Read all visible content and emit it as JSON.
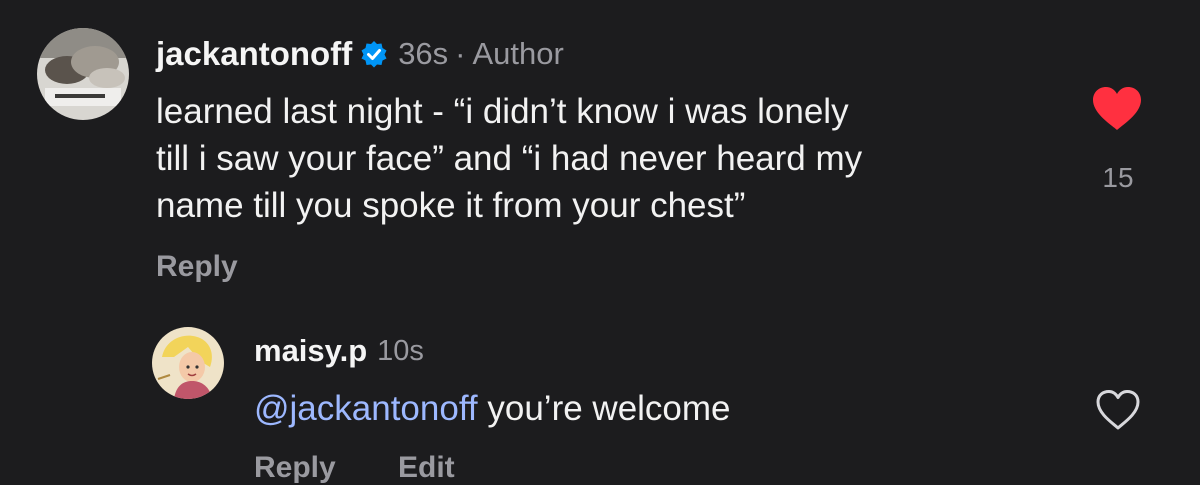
{
  "comment": {
    "username": "jackantonoff",
    "time": "36s",
    "separator": "·",
    "badge": "Author",
    "text_lines": [
      "learned last night - “i didn’t know i was lonely",
      "till i saw your face” and “i had never heard my",
      "name till you spoke it from your chest”"
    ],
    "reply_label": "Reply",
    "like_count": "15",
    "liked": true,
    "avatar_icon": "photo-avatar",
    "verified_icon": "verified-badge-icon"
  },
  "reply": {
    "username": "maisy.p",
    "time": "10s",
    "mention": "@jackantonoff",
    "text": " you’re welcome",
    "reply_label": "Reply",
    "edit_label": "Edit",
    "liked": false,
    "avatar_icon": "cartoon-avatar"
  },
  "colors": {
    "background": "#1c1c1e",
    "text": "#f2f2f2",
    "muted": "#9a9aa0",
    "mention": "#9db8ff",
    "like": "#ff3040",
    "verified": "#0095f6"
  }
}
